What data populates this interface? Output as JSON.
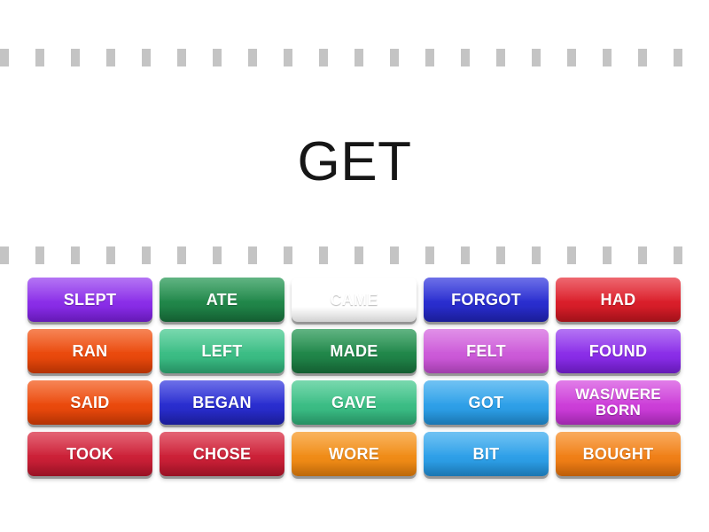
{
  "activity": {
    "type": "find-the-match",
    "prompt": "GET"
  },
  "separators": {
    "dash_color": "#c4c4c4",
    "dash_count": 20,
    "rows": 2
  },
  "tiles": [
    {
      "label": "SLEPT",
      "color": "#8b2fe8",
      "color_top": "#9a44f0",
      "color_bottom": "#7a1fdc",
      "lines": 1
    },
    {
      "label": "ATE",
      "color": "#21874a",
      "color_top": "#2a9a57",
      "color_bottom": "#18723c",
      "lines": 1
    },
    {
      "label": "CAME",
      "color": "#2fa0e8",
      "color_top": "#3fade f",
      "color_bottom": "#2190d8",
      "lines": 1
    },
    {
      "label": "FORGOT",
      "color": "#2a2ecf",
      "color_top": "#3a3ee0",
      "color_bottom": "#2023b8",
      "lines": 1
    },
    {
      "label": "HAD",
      "color": "#da1f2b",
      "color_top": "#e8333e",
      "color_bottom": "#c4151f",
      "lines": 1
    },
    {
      "label": "RAN",
      "color": "#ea4a0d",
      "color_top": "#f35a1c",
      "color_bottom": "#d93d05",
      "lines": 1
    },
    {
      "label": "LEFT",
      "color": "#3cbd85",
      "color_top": "#4acb92",
      "color_bottom": "#2fae77",
      "lines": 1
    },
    {
      "label": "MADE",
      "color": "#21874a",
      "color_top": "#2a9a57",
      "color_bottom": "#18723c",
      "lines": 1
    },
    {
      "label": "FELT",
      "color": "#cc5bd8",
      "color_top": "#d66ae0",
      "color_bottom": "#c24bcf",
      "lines": 1
    },
    {
      "label": "FOUND",
      "color": "#8b2fe8",
      "color_top": "#9a44f0",
      "color_bottom": "#7a1fdc",
      "lines": 1
    },
    {
      "label": "SAID",
      "color": "#ea4a0d",
      "color_top": "#f35a1c",
      "color_bottom": "#d93d05",
      "lines": 1
    },
    {
      "label": "BEGAN",
      "color": "#2a2ecf",
      "color_top": "#3a3ee0",
      "color_bottom": "#2023b8",
      "lines": 1
    },
    {
      "label": "GAVE",
      "color": "#3cbd85",
      "color_top": "#4acb92",
      "color_bottom": "#2fae77",
      "lines": 1
    },
    {
      "label": "GOT",
      "color": "#2fa0e8",
      "color_top": "#3fadef",
      "color_bottom": "#2190d8",
      "lines": 1
    },
    {
      "label": "WAS/WERE\nBORN",
      "color": "#cc3fd8",
      "color_top": "#d650e0",
      "color_bottom": "#bf2fcf",
      "lines": 2
    },
    {
      "label": "TOOK",
      "color": "#cc2138",
      "color_top": "#da3046",
      "color_bottom": "#b8162c",
      "lines": 1
    },
    {
      "label": "CHOSE",
      "color": "#cc2138",
      "color_top": "#da3046",
      "color_bottom": "#b8162c",
      "lines": 1
    },
    {
      "label": "WORE",
      "color": "#f08c18",
      "color_top": "#f79a27",
      "color_bottom": "#e57f0c",
      "lines": 1
    },
    {
      "label": "BIT",
      "color": "#2fa0e8",
      "color_top": "#3fadef",
      "color_bottom": "#2190d8",
      "lines": 1
    },
    {
      "label": "BOUGHT",
      "color": "#f08018",
      "color_top": "#f78e27",
      "color_bottom": "#e5720c",
      "lines": 1
    }
  ]
}
